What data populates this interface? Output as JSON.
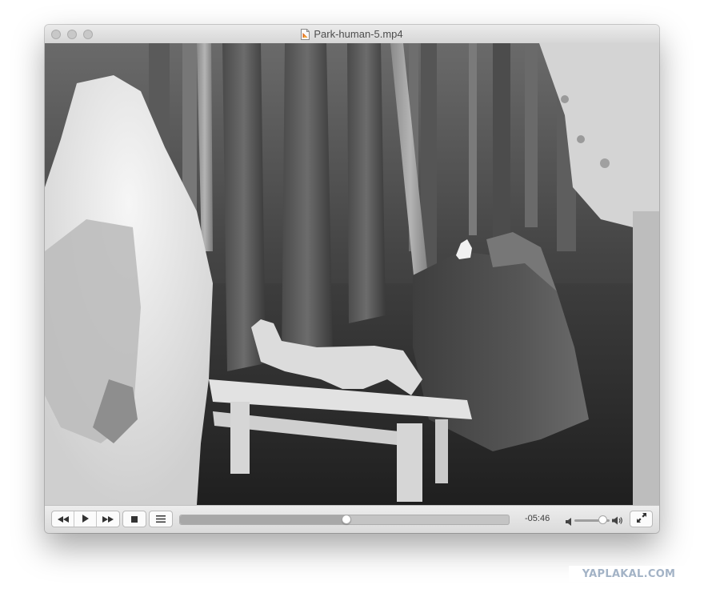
{
  "window": {
    "title": "Park-human-5.mp4",
    "file_icon": "video-file-icon"
  },
  "controls": {
    "rewind_icon": "rewind-icon",
    "play_icon": "play-icon",
    "fast_forward_icon": "fast-forward-icon",
    "stop_icon": "stop-icon",
    "playlist_icon": "playlist-icon",
    "time_remaining": "-05:46",
    "playback_progress": 0.505,
    "volume_level": 0.8,
    "volume_low_icon": "speaker-low-icon",
    "volume_high_icon": "speaker-high-icon",
    "fullscreen_icon": "fullscreen-icon"
  },
  "video": {
    "description_icon": "thermal-video-frame"
  },
  "watermark": {
    "text": "YAPLAKAL.COM"
  }
}
